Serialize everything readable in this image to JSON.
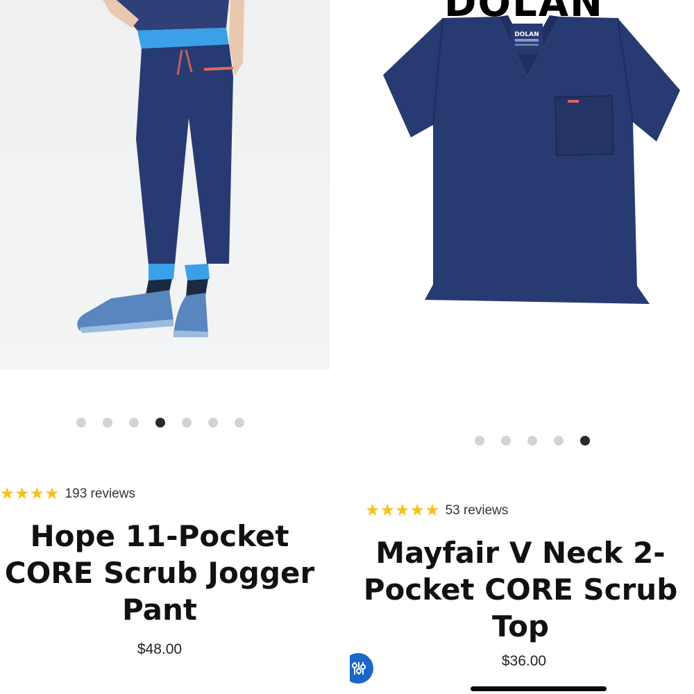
{
  "left_product": {
    "dots": 7,
    "active_dot": 3,
    "stars": "★★★★★",
    "reviews": "193 reviews",
    "title_lines": [
      "Hope 11-Pocket",
      "CORE Scrub Jogger",
      "Pant"
    ],
    "price": "$48.00"
  },
  "right_product": {
    "brand_banner": "DOLAN",
    "label_brand": "DOLAN",
    "dots": 5,
    "active_dot": 4,
    "stars": "★★★★★",
    "reviews": "53 reviews",
    "title_lines": [
      "Mayfair V Neck 2-",
      "Pocket CORE Scrub",
      "Top"
    ],
    "price": "$36.00"
  },
  "icons": {
    "filter": "sliders-icon"
  },
  "colors": {
    "navy": "#283a72",
    "star": "#f6c21a",
    "fab": "#1a67c9"
  }
}
